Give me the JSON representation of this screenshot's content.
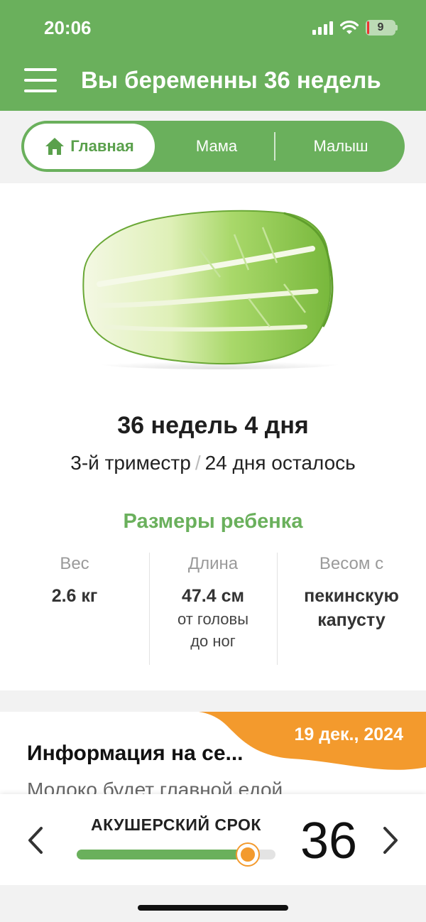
{
  "status_bar": {
    "time": "20:06",
    "battery": "9"
  },
  "header": {
    "title": "Вы беременны 36 недель",
    "menu_icon": "hamburger-icon"
  },
  "tabs": [
    {
      "label": "Главная",
      "icon": "home-icon",
      "active": true
    },
    {
      "label": "Мама",
      "active": false
    },
    {
      "label": "Малыш",
      "active": false
    }
  ],
  "week_card": {
    "image": "chinese-cabbage-illustration",
    "title": "36 недель 4 дня",
    "trimester": "3-й триместр",
    "separator": "/",
    "days_left": "24 дня осталось",
    "sizes_title": "Размеры ребенка",
    "sizes": [
      {
        "label": "Вес",
        "value": "2.6 кг",
        "note": ""
      },
      {
        "label": "Длина",
        "value": "47.4 см",
        "note": "от головы до ног"
      },
      {
        "label": "Весом с",
        "value": "пекинскую капусту",
        "note": ""
      }
    ]
  },
  "info_card": {
    "date": "19 дек., 2024",
    "title": "Информация на се...",
    "preview": "Молоко будет главной едой"
  },
  "term_panel": {
    "label": "АКУШЕРСКИЙ СРОК",
    "week": "36",
    "progress": 0.86,
    "prev_icon": "chevron-left-icon",
    "next_icon": "chevron-right-icon"
  },
  "colors": {
    "brand_green": "#6ab05c",
    "accent_orange": "#f39a2d"
  }
}
